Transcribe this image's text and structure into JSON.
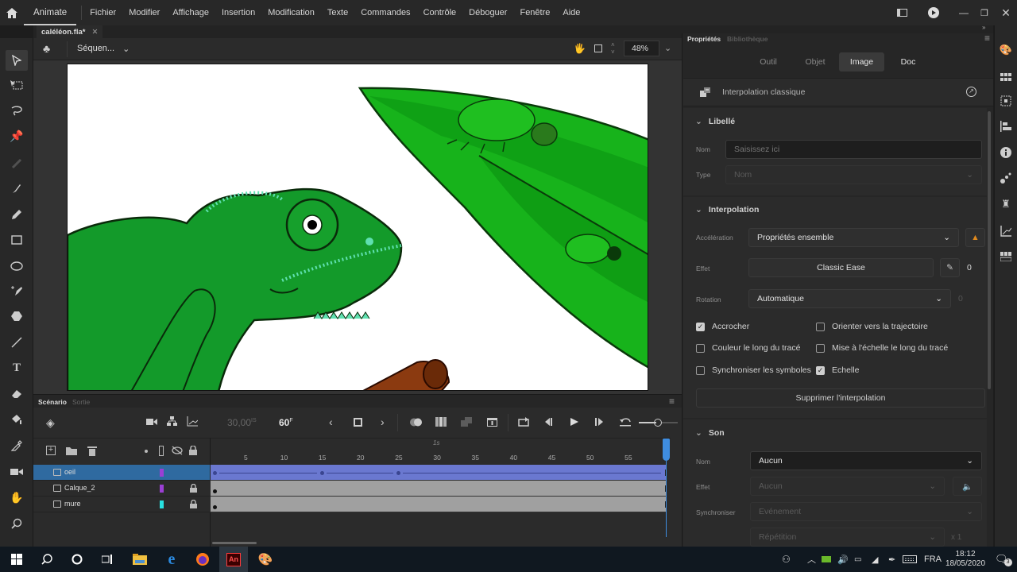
{
  "app": {
    "name": "Animate",
    "menu": [
      "Fichier",
      "Modifier",
      "Affichage",
      "Insertion",
      "Modification",
      "Texte",
      "Commandes",
      "Contrôle",
      "Déboguer",
      "Fenêtre",
      "Aide"
    ]
  },
  "document": {
    "tab_title": "caléléon.fla*",
    "scene_label": "Séquen...",
    "zoom": "48%"
  },
  "tools": [
    "selection",
    "subselection",
    "lasso",
    "pin",
    "width-disabled",
    "brush",
    "pencil",
    "rectangle",
    "oval",
    "pen-add",
    "polystar",
    "line",
    "text",
    "eraser",
    "paint-bucket",
    "eyedropper",
    "camera",
    "hand",
    "zoom"
  ],
  "timeline": {
    "tabs": [
      "Scénario",
      "Sortie"
    ],
    "fps": "30,00",
    "fps_unit": "IS",
    "current_frame": "60",
    "frame_unit": "F",
    "ruler_labels": [
      "5",
      "10",
      "15",
      "20",
      "25",
      "30",
      "35",
      "40",
      "45",
      "50",
      "55"
    ],
    "second_marker": "1s",
    "total_frames": 60,
    "layers": [
      {
        "name": "oeil",
        "color": "#9b3fd4",
        "locked": false,
        "selected": true,
        "keyframes": [
          1,
          15,
          25
        ],
        "tween": "classic"
      },
      {
        "name": "Calque_2",
        "color": "#9b3fd4",
        "locked": true,
        "selected": false,
        "keyframes": [
          1
        ],
        "tween": null
      },
      {
        "name": "mure",
        "color": "#27e0e0",
        "locked": true,
        "selected": false,
        "keyframes": [
          1
        ],
        "tween": null
      }
    ]
  },
  "properties": {
    "tabs": [
      "Propriétés",
      "Bibliothèque"
    ],
    "subtabs": [
      "Outil",
      "Objet",
      "Image",
      "Doc"
    ],
    "active_subtab": "Image",
    "object_type": "Interpolation classique",
    "libelle": {
      "title": "Libellé",
      "name_label": "Nom",
      "name_placeholder": "Saisissez ici",
      "type_label": "Type",
      "type_value": "Nom"
    },
    "interpolation": {
      "title": "Interpolation",
      "acceleration_label": "Accélération",
      "acceleration_value": "Propriétés ensemble",
      "effect_label": "Effet",
      "effect_value": "Classic Ease",
      "effect_amount": "0",
      "rotation_label": "Rotation",
      "rotation_value": "Automatique",
      "rotation_count": "0",
      "checkboxes": [
        {
          "label": "Accrocher",
          "checked": true
        },
        {
          "label": "Orienter vers la trajectoire",
          "checked": false
        },
        {
          "label": "Couleur le long du tracé",
          "checked": false
        },
        {
          "label": "Mise à l'échelle le long du tracé",
          "checked": false
        },
        {
          "label": "Synchroniser les symboles",
          "checked": false
        },
        {
          "label": "Echelle",
          "checked": true
        }
      ],
      "remove_button": "Supprimer l'interpolation"
    },
    "son": {
      "title": "Son",
      "name_label": "Nom",
      "name_value": "Aucun",
      "effect_label": "Effet",
      "effect_value": "Aucun",
      "sync_label": "Synchroniser",
      "sync_value": "Evénement",
      "repeat_value": "Répétition",
      "repeat_count": "x 1"
    }
  },
  "taskbar": {
    "language": "FRA",
    "time": "18:12",
    "date": "18/05/2020",
    "notifications": "3"
  }
}
